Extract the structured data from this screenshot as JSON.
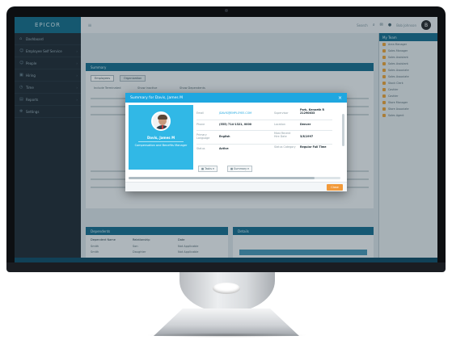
{
  "app": {
    "logo": "EPICOR",
    "menu_icon": "≡"
  },
  "topbar": {
    "search_placeholder": "Search",
    "user_name": "Bob Johnson",
    "user_initial": "B"
  },
  "sidebar": {
    "items": [
      {
        "icon": "home-icon",
        "label": "Dashboard"
      },
      {
        "icon": "people-icon",
        "label": "Employee Self Service"
      },
      {
        "icon": "people-icon",
        "label": "People"
      },
      {
        "icon": "briefcase-icon",
        "label": "Hiring"
      },
      {
        "icon": "clock-icon",
        "label": "Time"
      },
      {
        "icon": "chart-icon",
        "label": "Reports"
      },
      {
        "icon": "gear-icon",
        "label": "Settings"
      }
    ]
  },
  "main": {
    "panel_title": "Summary",
    "tabs": [
      "Employees",
      "Organization"
    ],
    "filters": [
      "Include Terminated",
      "Show Inactive",
      "Show Dependents"
    ],
    "lower_left_title": "Dependents",
    "lower_right_title": "Details",
    "table_headers": [
      "Dependent Name",
      "Relationship",
      "Date"
    ],
    "table_rows": [
      [
        "Smith",
        "Son",
        "Not Applicable"
      ],
      [
        "Smith",
        "Daughter",
        "Not Applicable"
      ]
    ]
  },
  "right_panel": {
    "title": "My Team",
    "items": [
      "Area Manager",
      "Sales Manager",
      "Sales Assistant",
      "Sales Assistant",
      "Sales Associate",
      "Sales Associate",
      "Stock Clerk",
      "Cashier",
      "Cashier",
      "Store Manager",
      "Store Associate",
      "Sales Agent"
    ]
  },
  "modal": {
    "title": "Summary for Davis, James M",
    "close_icon": "×",
    "profile": {
      "name": "Davis, James M",
      "department": "Compensation and Benefits Manager"
    },
    "fields_left": [
      {
        "label": "Email",
        "value": "JDAVIS@EMPLOYEE.COM",
        "link": true
      },
      {
        "label": "Phone",
        "value": "(555) 714-1321, 0000",
        "link": false
      },
      {
        "label": "Primary Language",
        "value": "English",
        "link": false
      },
      {
        "label": "Status",
        "value": "Active",
        "link": false
      }
    ],
    "fields_right": [
      {
        "label": "Supervisor",
        "value": "Park, Kenneth R 21290833"
      },
      {
        "label": "Location",
        "value": "Denver"
      },
      {
        "label": "Most Recent Hire Date",
        "value": "3/8/1997"
      },
      {
        "label": "Status Category",
        "value": "Regular Full Time"
      }
    ],
    "buttons": [
      "Tasks",
      "Summary"
    ],
    "close_label": "Close"
  },
  "colors": {
    "modal_header": "#1fa7e0",
    "profile_bg": "#31b8e6",
    "close_button": "#f29a3a",
    "app_teal": "#1b7090",
    "sidebar": "#24303a"
  }
}
